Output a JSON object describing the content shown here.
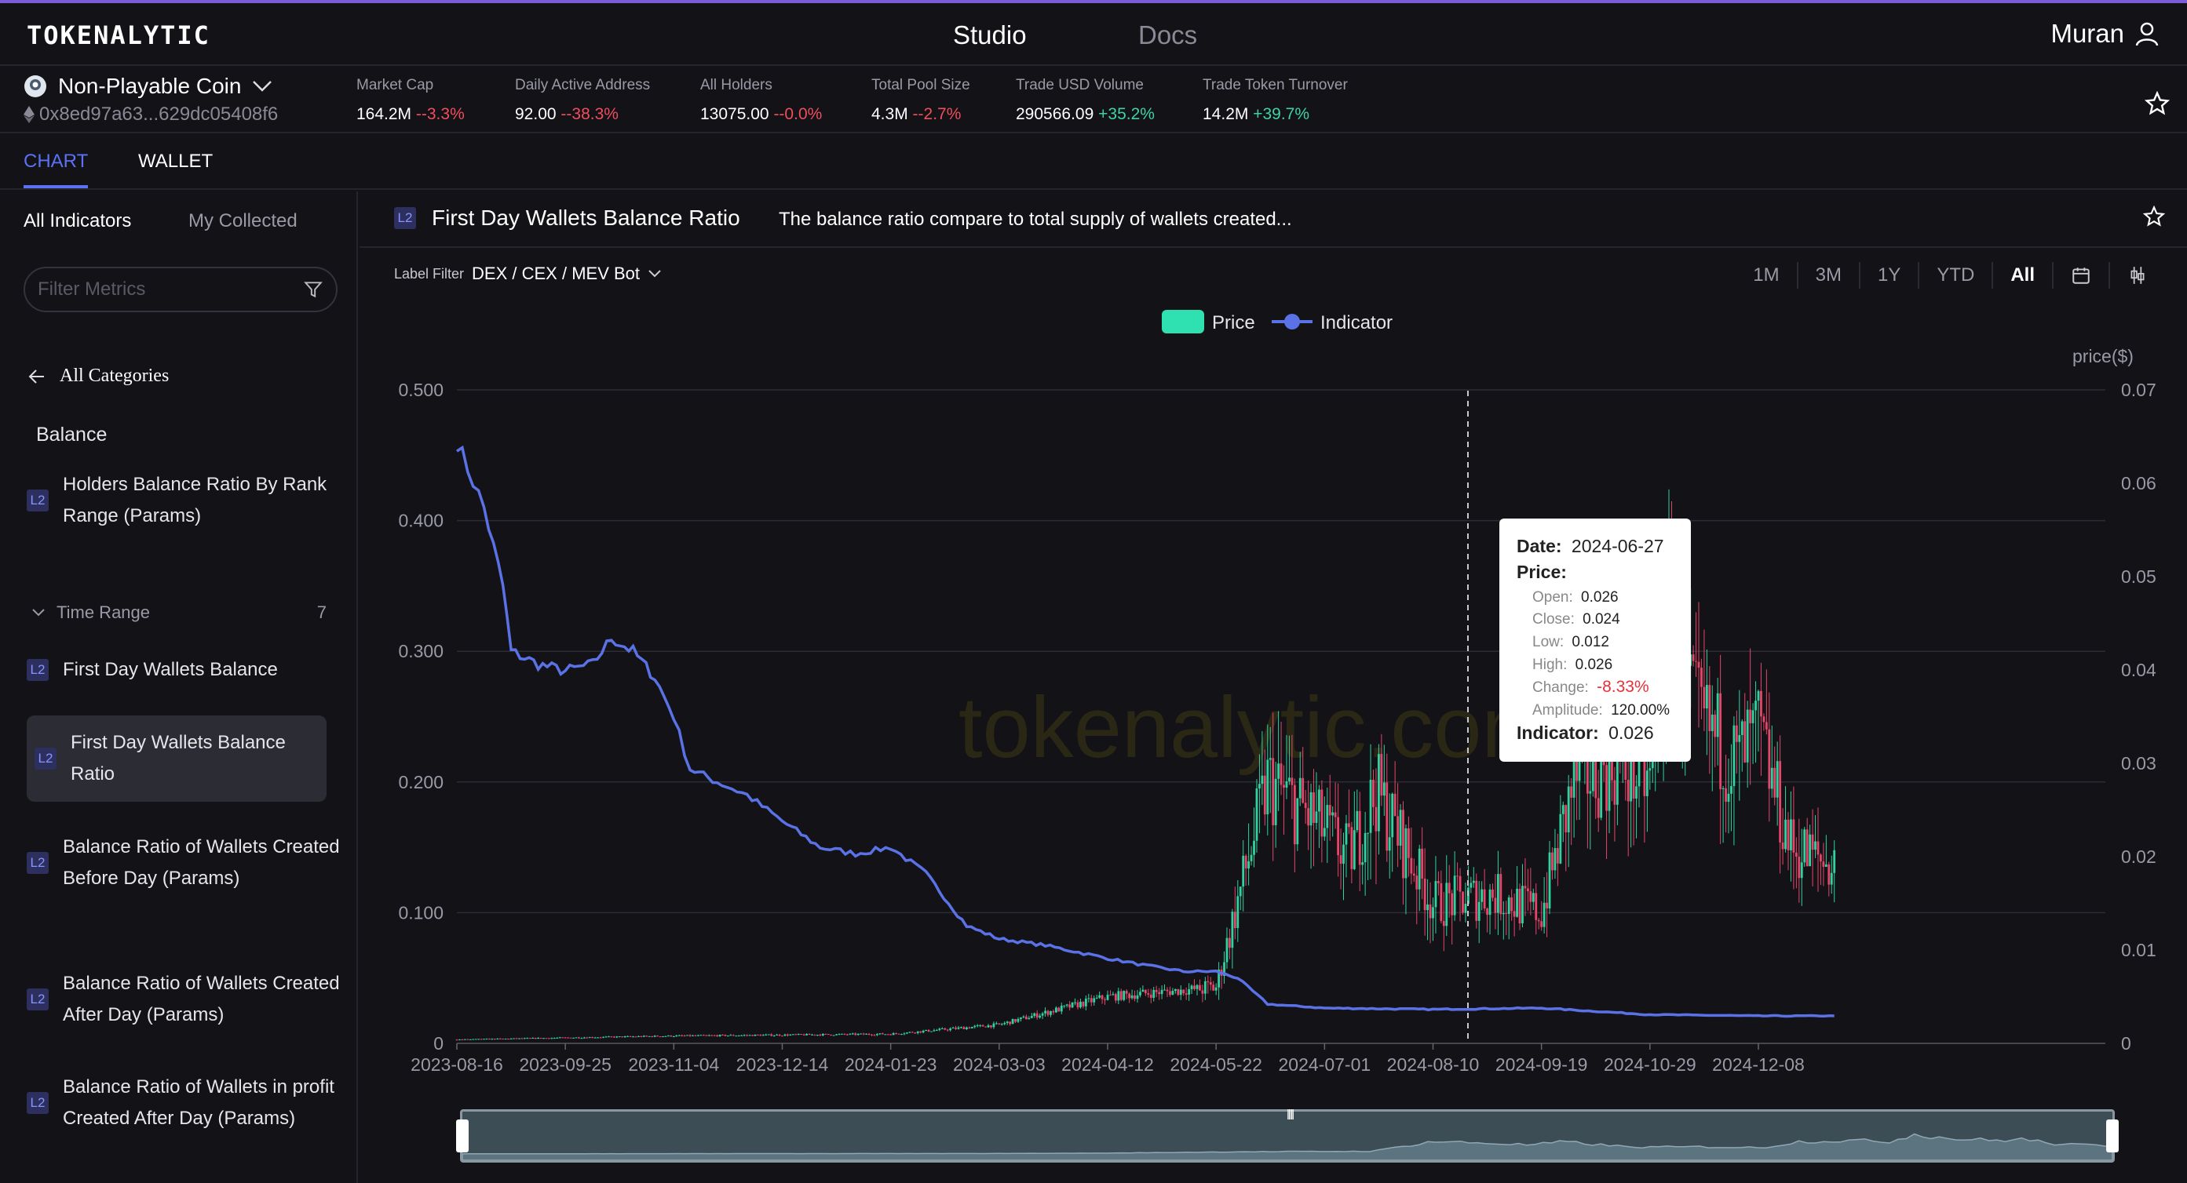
{
  "header": {
    "logo": "TOKENALYTIC",
    "nav": {
      "studio": "Studio",
      "docs": "Docs"
    },
    "user": "Muran"
  },
  "coin": {
    "name": "Non-Playable Coin",
    "address": "0x8ed97a63...629dc05408f6"
  },
  "stats": [
    {
      "label": "Market Cap",
      "value": "164.2M",
      "change": "--3.3%",
      "dir": "neg"
    },
    {
      "label": "Daily Active Address",
      "value": "92.00",
      "change": "--38.3%",
      "dir": "neg"
    },
    {
      "label": "All Holders",
      "value": "13075.00",
      "change": "--0.0%",
      "dir": "neg"
    },
    {
      "label": "Total Pool Size",
      "value": "4.3M",
      "change": "--2.7%",
      "dir": "neg"
    },
    {
      "label": "Trade USD Volume",
      "value": "290566.09",
      "change": "+35.2%",
      "dir": "pos"
    },
    {
      "label": "Trade Token Turnover",
      "value": "14.2M",
      "change": "+39.7%",
      "dir": "pos"
    }
  ],
  "tabs": {
    "chart": "CHART",
    "wallet": "WALLET"
  },
  "sidebar": {
    "tab_all": "All Indicators",
    "tab_collected": "My Collected",
    "filter_placeholder": "Filter Metrics",
    "all_categories": "All Categories",
    "category": "Balance",
    "badge": "L2",
    "item_balance_rank": "Holders Balance Ratio By Rank Range (Params)",
    "time_range": {
      "label": "Time Range",
      "count": "7"
    },
    "items": [
      {
        "label": "First Day Wallets Balance"
      },
      {
        "label": "First Day Wallets Balance Ratio"
      },
      {
        "label": "Balance Ratio of Wallets Created Before Day (Params)"
      },
      {
        "label": "Balance Ratio of Wallets Created After Day (Params)"
      },
      {
        "label": "Balance Ratio of Wallets in profit Created After Day (Params)"
      }
    ]
  },
  "panel": {
    "badge": "L2",
    "title": "First Day Wallets Balance Ratio",
    "description": "The balance ratio compare to total supply of wallets created...",
    "label_filter": {
      "label": "Label Filter",
      "value": "DEX / CEX / MEV Bot"
    },
    "ranges": [
      "1M",
      "3M",
      "1Y",
      "YTD",
      "All"
    ],
    "selected_range": "All",
    "watermark": "tokenalytic.com"
  },
  "tooltip": {
    "date_label": "Date:",
    "date": "2024-06-27",
    "price_label": "Price:",
    "open_label": "Open:",
    "open": "0.026",
    "close_label": "Close:",
    "close": "0.024",
    "low_label": "Low:",
    "low": "0.012",
    "high_label": "High:",
    "high": "0.026",
    "change_label": "Change:",
    "change": "-8.33%",
    "amplitude_label": "Amplitude:",
    "amplitude": "120.00%",
    "indicator_label": "Indicator:",
    "indicator": "0.026"
  },
  "colors": {
    "price": "#2fe0b0",
    "indicator": "#5b72e6",
    "up": "#2fd3a0",
    "down": "#e8456a",
    "accent": "#5b72f5"
  },
  "chart_data": {
    "type": "line",
    "legend": [
      "Price",
      "Indicator"
    ],
    "legend_position": "top-center",
    "y_left": {
      "ticks": [
        "0",
        "0.100",
        "0.200",
        "0.300",
        "0.400",
        "0.500"
      ],
      "range": [
        0,
        0.5
      ]
    },
    "y_right": {
      "label": "price($)",
      "ticks": [
        "0",
        "0.01",
        "0.02",
        "0.03",
        "0.04",
        "0.05",
        "0.06",
        "0.07"
      ],
      "range": [
        0,
        0.07
      ]
    },
    "x_ticks": [
      "2023-08-16",
      "2023-09-25",
      "2023-11-04",
      "2023-12-14",
      "2024-01-23",
      "2024-03-03",
      "2024-04-12",
      "2024-05-22",
      "2024-07-01",
      "2024-08-10",
      "2024-09-19",
      "2024-10-29",
      "2024-12-08"
    ],
    "grid": true,
    "series": [
      {
        "name": "Indicator",
        "x": [
          "2023-08-16",
          "2023-08-20",
          "2023-08-26",
          "2023-09-02",
          "2023-09-05",
          "2023-09-15",
          "2023-09-25",
          "2023-10-05",
          "2023-10-12",
          "2023-10-20",
          "2023-10-28",
          "2023-11-04",
          "2023-11-10",
          "2023-11-20",
          "2023-12-01",
          "2023-12-14",
          "2023-12-28",
          "2024-01-10",
          "2024-01-23",
          "2024-02-05",
          "2024-02-20",
          "2024-03-03",
          "2024-03-20",
          "2024-04-12",
          "2024-04-25",
          "2024-05-10",
          "2024-05-22",
          "2024-05-30",
          "2024-06-10",
          "2024-07-01",
          "2024-08-10",
          "2024-09-19",
          "2024-10-29",
          "2024-12-08",
          "2025-01-05"
        ],
        "values": [
          0.46,
          0.44,
          0.41,
          0.35,
          0.3,
          0.29,
          0.285,
          0.29,
          0.31,
          0.3,
          0.28,
          0.25,
          0.21,
          0.2,
          0.19,
          0.17,
          0.15,
          0.145,
          0.15,
          0.13,
          0.09,
          0.08,
          0.075,
          0.065,
          0.06,
          0.055,
          0.055,
          0.05,
          0.03,
          0.027,
          0.026,
          0.027,
          0.022,
          0.021,
          0.021
        ]
      },
      {
        "name": "Price",
        "x": [
          "2023-08-16",
          "2023-11-04",
          "2024-01-23",
          "2024-03-03",
          "2024-04-12",
          "2024-05-22",
          "2024-06-10",
          "2024-06-27",
          "2024-07-10",
          "2024-07-20",
          "2024-08-10",
          "2024-09-01",
          "2024-09-19",
          "2024-10-01",
          "2024-10-15",
          "2024-10-29",
          "2024-11-05",
          "2024-11-15",
          "2024-11-30",
          "2024-12-08",
          "2024-12-20",
          "2025-01-05"
        ],
        "values": [
          0.0004,
          0.0008,
          0.001,
          0.002,
          0.005,
          0.006,
          0.028,
          0.024,
          0.02,
          0.027,
          0.015,
          0.016,
          0.014,
          0.028,
          0.03,
          0.028,
          0.045,
          0.035,
          0.03,
          0.033,
          0.021,
          0.019
        ]
      }
    ]
  }
}
